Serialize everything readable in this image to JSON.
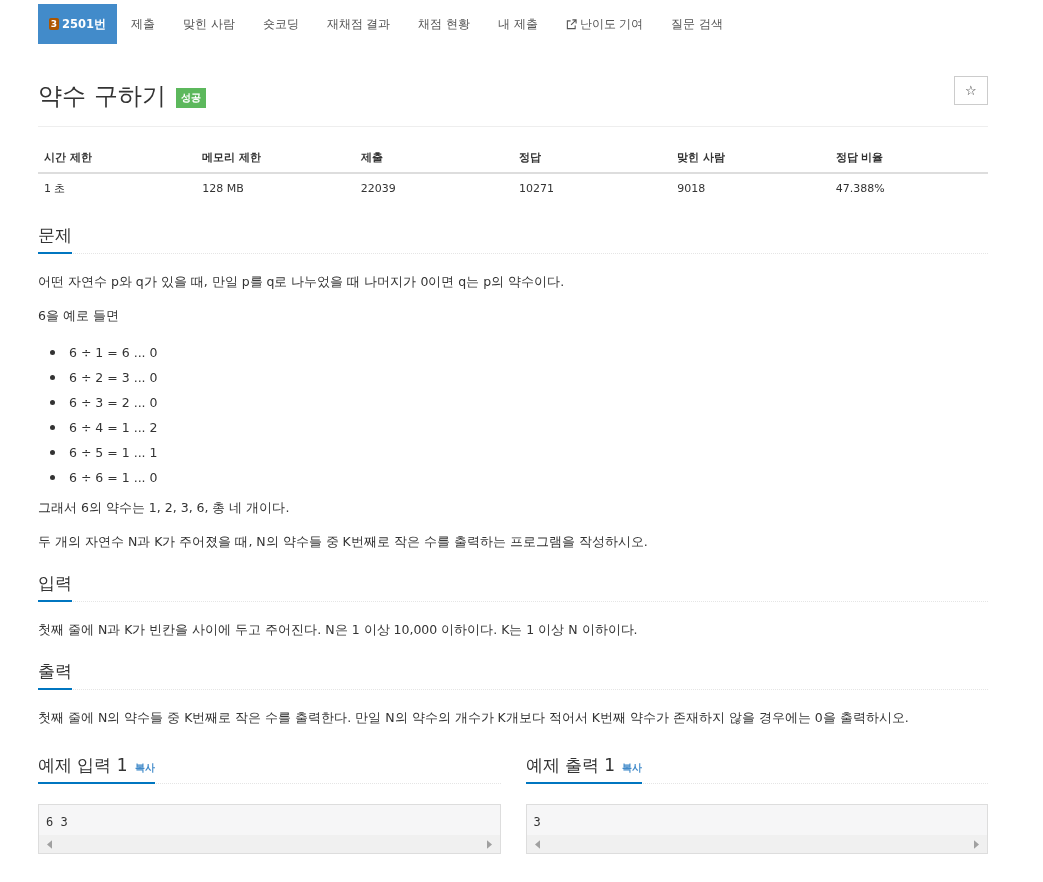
{
  "nav": {
    "tabs": [
      {
        "label": "2501번",
        "tier": "3",
        "selected": true,
        "external": false
      },
      {
        "label": "제출",
        "selected": false,
        "external": false
      },
      {
        "label": "맞힌 사람",
        "selected": false,
        "external": false
      },
      {
        "label": "숏코딩",
        "selected": false,
        "external": false
      },
      {
        "label": "재채점 결과",
        "selected": false,
        "external": false
      },
      {
        "label": "채점 현황",
        "selected": false,
        "external": false
      },
      {
        "label": "내 제출",
        "selected": false,
        "external": false
      },
      {
        "label": "난이도 기여",
        "selected": false,
        "external": true
      },
      {
        "label": "질문 검색",
        "selected": false,
        "external": false
      }
    ]
  },
  "title": "약수 구하기",
  "status_badge": "성공",
  "star_button": "☆",
  "info_table": {
    "columns": [
      "시간 제한",
      "메모리 제한",
      "제출",
      "정답",
      "맞힌 사람",
      "정답 비율"
    ],
    "rows": [
      [
        "1 초",
        "128 MB",
        "22039",
        "10271",
        "9018",
        "47.388%"
      ]
    ]
  },
  "sections": [
    {
      "heading": "문제",
      "blocks": [
        {
          "kind": "para",
          "text": "어떤 자연수 p와 q가 있을 때, 만일 p를 q로 나누었을 때 나머지가 0이면 q는 p의 약수이다."
        },
        {
          "kind": "para",
          "text": "6을 예로 들면"
        },
        {
          "kind": "list",
          "items": [
            "6 ÷ 1 = 6 ... 0",
            "6 ÷ 2 = 3 ... 0",
            "6 ÷ 3 = 2 ... 0",
            "6 ÷ 4 = 1 ... 2",
            "6 ÷ 5 = 1 ... 1",
            "6 ÷ 6 = 1 ... 0"
          ]
        },
        {
          "kind": "para",
          "text": "그래서 6의 약수는 1, 2, 3, 6, 총 네 개이다."
        },
        {
          "kind": "para",
          "text": "두 개의 자연수 N과 K가 주어졌을 때, N의 약수들 중 K번째로 작은 수를 출력하는 프로그램을 작성하시오."
        }
      ]
    },
    {
      "heading": "입력",
      "blocks": [
        {
          "kind": "para",
          "text": "첫째 줄에 N과 K가 빈칸을 사이에 두고 주어진다. N은 1 이상 10,000 이하이다. K는 1 이상 N 이하이다."
        }
      ]
    },
    {
      "heading": "출력",
      "blocks": [
        {
          "kind": "para",
          "text": "첫째 줄에 N의 약수들 중 K번째로 작은 수를 출력한다. 만일 N의 약수의 개수가 K개보다 적어서 K번째 약수가 존재하지 않을 경우에는 0을 출력하시오."
        }
      ]
    }
  ],
  "samples": [
    {
      "heading": "예제 입력 1",
      "copy": "복사",
      "content": "6 3"
    },
    {
      "heading": "예제 출력 1",
      "copy": "복사",
      "content": "3"
    }
  ]
}
